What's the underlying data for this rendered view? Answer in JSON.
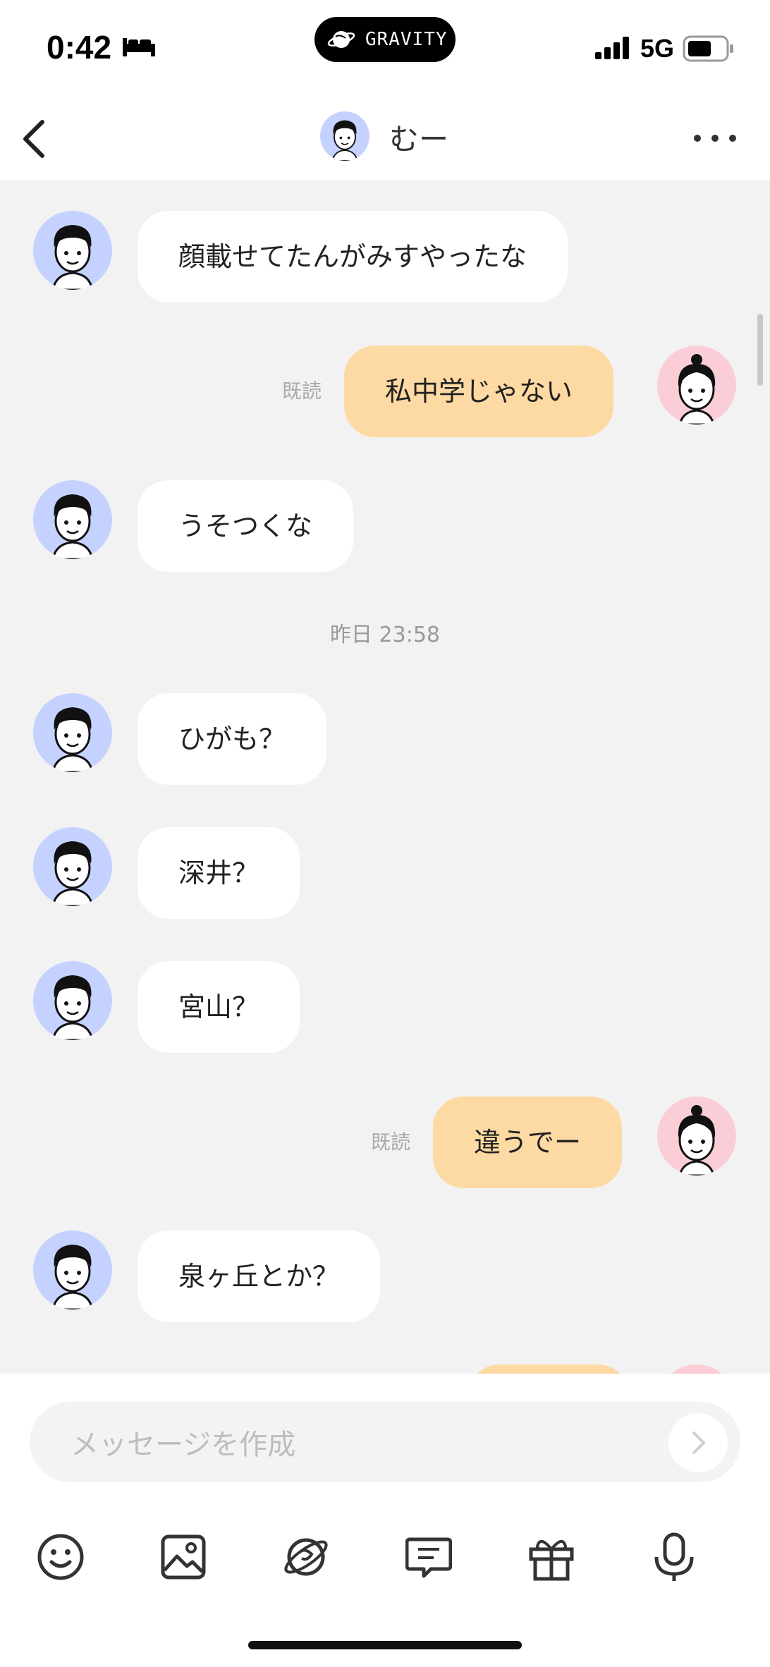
{
  "status_bar": {
    "time": "0:42",
    "pill_label": "GRAVITY",
    "network": "5G"
  },
  "header": {
    "contact_name": "むー"
  },
  "messages": [
    {
      "side": "in",
      "text": "顔載せてたんがみすやったな"
    },
    {
      "side": "out",
      "text": "私中学じゃない",
      "read": "既読"
    },
    {
      "side": "in",
      "text": "うそつくな"
    },
    {
      "side": "ts",
      "text": "昨日 23:58"
    },
    {
      "side": "in",
      "text": "ひがも？"
    },
    {
      "side": "in",
      "text": "深井？"
    },
    {
      "side": "in",
      "text": "宮山？"
    },
    {
      "side": "out",
      "text": "違うでー",
      "read": "既読"
    },
    {
      "side": "in",
      "text": "泉ヶ丘とか？"
    }
  ],
  "composer": {
    "placeholder": "メッセージを作成",
    "tools": [
      "smile-icon",
      "image-icon",
      "planet-icon",
      "chat-list-icon",
      "gift-icon",
      "microphone-icon"
    ]
  },
  "colors": {
    "background": "#f2f2f2",
    "incoming_bubble": "#ffffff",
    "outgoing_bubble": "#fdd9a3",
    "boy_avatar_bg": "#c5d2ff",
    "girl_avatar_bg": "#fbcdd6"
  }
}
